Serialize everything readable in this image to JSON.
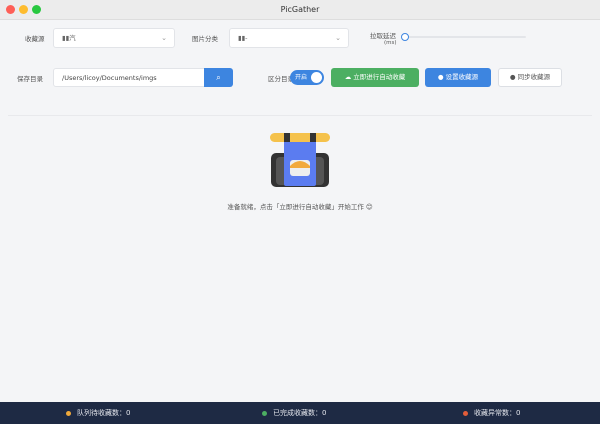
{
  "window": {
    "title": "PicGather"
  },
  "source": {
    "label": "收藏源",
    "value": "▮▮汽"
  },
  "category": {
    "label": "图片分类",
    "value": "▮▮-"
  },
  "delay": {
    "label": "拉取延迟",
    "unit": "(ms)",
    "value": 0
  },
  "save_dir": {
    "label": "保存目录",
    "value": "/Users/licoy/Documents/imgs"
  },
  "split_dir": {
    "label": "区分目录",
    "toggle_label": "开启",
    "on": true
  },
  "buttons": {
    "start": "立即进行自动收藏",
    "set_source": "设置收藏源",
    "sync_source": "同步收藏源"
  },
  "main": {
    "message": "准备就绪，点击「立即进行自动收藏」开始工作 😊"
  },
  "footer": {
    "pending": "队列待收藏数：0",
    "done": "已完成收藏数：0",
    "error": "收藏异常数：0"
  },
  "colors": {
    "blue": "#3d85e0",
    "green": "#4caf62",
    "footer": "#1e2a44"
  }
}
